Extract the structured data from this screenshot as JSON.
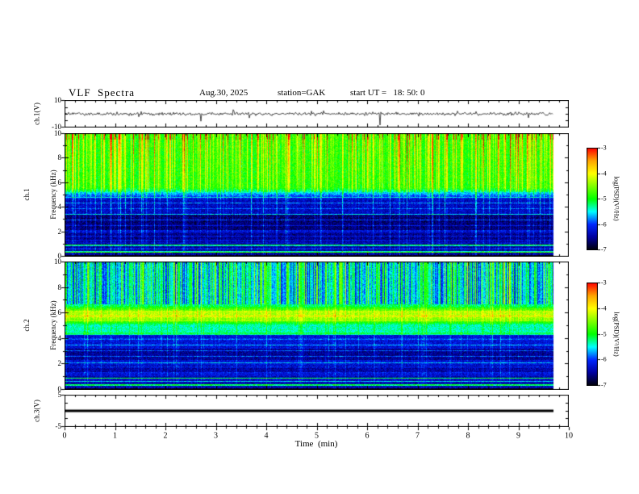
{
  "title": "VLF  Spectra",
  "header": {
    "date": "Aug.30, 2025",
    "station": "station=GAK",
    "start_ut": "start UT =   18: 50: 0"
  },
  "xaxis": {
    "label": "Time  (min)",
    "min": 0,
    "max": 10,
    "ticks": [
      "0",
      "1",
      "2",
      "3",
      "4",
      "5",
      "6",
      "7",
      "8",
      "9",
      "10"
    ],
    "minor_tick_step_min": 0.2
  },
  "record_length_min": 9.7,
  "colors": {
    "background": "#ffffff",
    "frame": "#000000",
    "trace": "#000000"
  },
  "chart_data": [
    {
      "type": "line",
      "name": "ch1-waveform",
      "ylabel": "ch.1(V)",
      "ylim": [
        -10,
        10
      ],
      "ytick_values": [
        10,
        -10
      ],
      "ytick_labels": [
        "10",
        "-10"
      ],
      "xlim": [
        0,
        10
      ],
      "description": "Broadband noise of roughly ±1.5 V about 0 V with frequent impulsive downward spikes reaching about -4 to -9 V and occasional upward spikes to about +3 V over the full 0–9.7 min record."
    },
    {
      "type": "heatmap",
      "name": "ch1-spectrogram",
      "ylabel_lines": [
        "ch.1",
        "Frequency (kHz)"
      ],
      "ylim": [
        0,
        10
      ],
      "ytick_values": [
        0,
        2,
        4,
        6,
        8,
        10
      ],
      "ytick_labels": [
        "0",
        "2",
        "4",
        "6",
        "8",
        "10"
      ],
      "zlabel": "log(PSD)(V²/Hz)",
      "zlim": [
        -7,
        -3
      ],
      "colorbar_tick_values": [
        -3,
        -4,
        -5,
        -6,
        -7
      ],
      "colorbar_tick_labels": [
        "-3",
        "-4",
        "-5",
        "-6",
        "-7"
      ],
      "description": "Intense broadband sferic activity above ~5.5 kHz: green background near -5 with dense yellow-to-red vertical streaks reaching -3. Dark blue background (~-6.5) from ~1–5.5 kHz crossed by thin cyan horizontal harmonic lines, with darker bands near 1.2–1.9 and 2.1–3.4 kHz. Bright green/yellow narrowband lines near 0.35 and 0.9 kHz; full-height vertical streaks from strong sferics."
    },
    {
      "type": "heatmap",
      "name": "ch2-spectrogram",
      "ylabel_lines": [
        "ch.2",
        "Frequency (kHz)"
      ],
      "ylim": [
        0,
        10
      ],
      "ytick_values": [
        0,
        2,
        4,
        6,
        8,
        10
      ],
      "ytick_labels": [
        "0",
        "2",
        "4",
        "6",
        "8",
        "10"
      ],
      "zlabel": "log(PSD)(V²/Hz)",
      "zlim": [
        -7,
        -3
      ],
      "colorbar_tick_values": [
        -3,
        -4,
        -5,
        -6,
        -7
      ],
      "colorbar_tick_labels": [
        "-3",
        "-4",
        "-5",
        "-6",
        "-7"
      ],
      "description": "Blue background above ~6.7 kHz with dense cyan-green vertical sferic streaks. Bright green band (~-4.5) between ~5.1–6.7 kHz containing thin yellow lines; cyan-green mix 4.3–5.1 kHz; blue background with cyan harmonic lines and darker bands below 4.3 kHz; bright green lines near 0.35 and 0.85 kHz."
    },
    {
      "type": "line",
      "name": "ch3-waveform",
      "ylabel": "ch.3(V)",
      "ylim": [
        -5,
        5
      ],
      "ytick_values": [
        5,
        -5
      ],
      "ytick_labels": [
        "5",
        "-5"
      ],
      "xlim": [
        0,
        10
      ],
      "description": "Constant flat trace at 0 V drawn as a thick black line across the full record."
    }
  ]
}
